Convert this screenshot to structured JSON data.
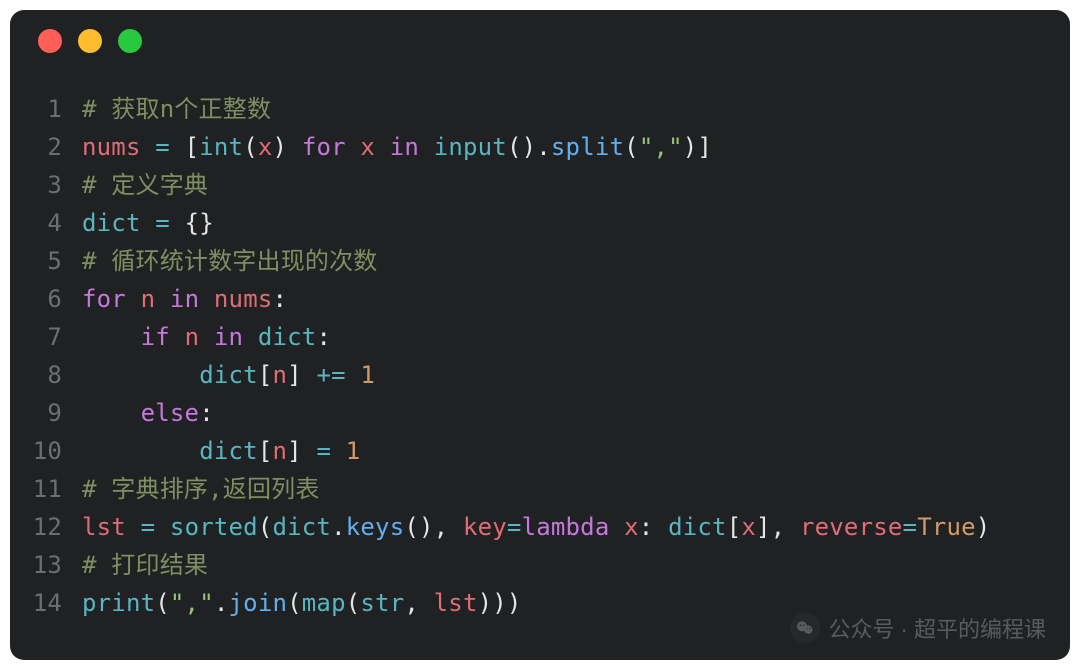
{
  "window": {
    "traffic_lights": [
      "close",
      "minimize",
      "zoom"
    ]
  },
  "colors": {
    "bg": "#1f2122",
    "gutter": "#6a6f73",
    "comment": "#7f8f61",
    "keyword": "#c678dd",
    "ident": "#e06c75",
    "string": "#98c379",
    "func": "#61afef",
    "operator": "#56b6c2",
    "builtin": "#56b6c2",
    "number": "#d19a66",
    "literal": "#d19a66",
    "plain": "#e5e5e5"
  },
  "code": {
    "language": "python",
    "lines": [
      {
        "n": "1",
        "tokens": [
          {
            "c": "cmt",
            "t": "# 获取n个正整数"
          }
        ]
      },
      {
        "n": "2",
        "tokens": [
          {
            "c": "id",
            "t": "nums"
          },
          {
            "c": "pl",
            "t": " "
          },
          {
            "c": "op",
            "t": "="
          },
          {
            "c": "pl",
            "t": " ["
          },
          {
            "c": "bi",
            "t": "int"
          },
          {
            "c": "pl",
            "t": "("
          },
          {
            "c": "id",
            "t": "x"
          },
          {
            "c": "pl",
            "t": ") "
          },
          {
            "c": "kw",
            "t": "for"
          },
          {
            "c": "pl",
            "t": " "
          },
          {
            "c": "id",
            "t": "x"
          },
          {
            "c": "pl",
            "t": " "
          },
          {
            "c": "kw",
            "t": "in"
          },
          {
            "c": "pl",
            "t": " "
          },
          {
            "c": "bi",
            "t": "input"
          },
          {
            "c": "pl",
            "t": "()."
          },
          {
            "c": "fn",
            "t": "split"
          },
          {
            "c": "pl",
            "t": "("
          },
          {
            "c": "str",
            "t": "\",\""
          },
          {
            "c": "pl",
            "t": ")]"
          }
        ]
      },
      {
        "n": "3",
        "tokens": [
          {
            "c": "cmt",
            "t": "# 定义字典"
          }
        ]
      },
      {
        "n": "4",
        "tokens": [
          {
            "c": "bi",
            "t": "dict"
          },
          {
            "c": "pl",
            "t": " "
          },
          {
            "c": "op",
            "t": "="
          },
          {
            "c": "pl",
            "t": " {}"
          }
        ]
      },
      {
        "n": "5",
        "tokens": [
          {
            "c": "cmt",
            "t": "# 循环统计数字出现的次数"
          }
        ]
      },
      {
        "n": "6",
        "tokens": [
          {
            "c": "kw",
            "t": "for"
          },
          {
            "c": "pl",
            "t": " "
          },
          {
            "c": "id",
            "t": "n"
          },
          {
            "c": "pl",
            "t": " "
          },
          {
            "c": "kw",
            "t": "in"
          },
          {
            "c": "pl",
            "t": " "
          },
          {
            "c": "id",
            "t": "nums"
          },
          {
            "c": "pl",
            "t": ":"
          }
        ]
      },
      {
        "n": "7",
        "tokens": [
          {
            "c": "pl",
            "t": "    "
          },
          {
            "c": "kw",
            "t": "if"
          },
          {
            "c": "pl",
            "t": " "
          },
          {
            "c": "id",
            "t": "n"
          },
          {
            "c": "pl",
            "t": " "
          },
          {
            "c": "kw",
            "t": "in"
          },
          {
            "c": "pl",
            "t": " "
          },
          {
            "c": "bi",
            "t": "dict"
          },
          {
            "c": "pl",
            "t": ":"
          }
        ]
      },
      {
        "n": "8",
        "tokens": [
          {
            "c": "pl",
            "t": "        "
          },
          {
            "c": "bi",
            "t": "dict"
          },
          {
            "c": "pl",
            "t": "["
          },
          {
            "c": "id",
            "t": "n"
          },
          {
            "c": "pl",
            "t": "] "
          },
          {
            "c": "op",
            "t": "+="
          },
          {
            "c": "pl",
            "t": " "
          },
          {
            "c": "num",
            "t": "1"
          }
        ]
      },
      {
        "n": "9",
        "tokens": [
          {
            "c": "pl",
            "t": "    "
          },
          {
            "c": "kw",
            "t": "else"
          },
          {
            "c": "pl",
            "t": ":"
          }
        ]
      },
      {
        "n": "10",
        "tokens": [
          {
            "c": "pl",
            "t": "        "
          },
          {
            "c": "bi",
            "t": "dict"
          },
          {
            "c": "pl",
            "t": "["
          },
          {
            "c": "id",
            "t": "n"
          },
          {
            "c": "pl",
            "t": "] "
          },
          {
            "c": "op",
            "t": "="
          },
          {
            "c": "pl",
            "t": " "
          },
          {
            "c": "num",
            "t": "1"
          }
        ]
      },
      {
        "n": "11",
        "tokens": [
          {
            "c": "cmt",
            "t": "# 字典排序,返回列表"
          }
        ]
      },
      {
        "n": "12",
        "tokens": [
          {
            "c": "id",
            "t": "lst"
          },
          {
            "c": "pl",
            "t": " "
          },
          {
            "c": "op",
            "t": "="
          },
          {
            "c": "pl",
            "t": " "
          },
          {
            "c": "bi",
            "t": "sorted"
          },
          {
            "c": "pl",
            "t": "("
          },
          {
            "c": "bi",
            "t": "dict"
          },
          {
            "c": "pl",
            "t": "."
          },
          {
            "c": "fn",
            "t": "keys"
          },
          {
            "c": "pl",
            "t": "(), "
          },
          {
            "c": "id",
            "t": "key"
          },
          {
            "c": "op",
            "t": "="
          },
          {
            "c": "kw",
            "t": "lambda"
          },
          {
            "c": "pl",
            "t": " "
          },
          {
            "c": "id",
            "t": "x"
          },
          {
            "c": "pl",
            "t": ": "
          },
          {
            "c": "bi",
            "t": "dict"
          },
          {
            "c": "pl",
            "t": "["
          },
          {
            "c": "id",
            "t": "x"
          },
          {
            "c": "pl",
            "t": "], "
          },
          {
            "c": "id",
            "t": "reverse"
          },
          {
            "c": "op",
            "t": "="
          },
          {
            "c": "lit",
            "t": "True"
          },
          {
            "c": "pl",
            "t": ")"
          }
        ]
      },
      {
        "n": "13",
        "tokens": [
          {
            "c": "cmt",
            "t": "# 打印结果"
          }
        ]
      },
      {
        "n": "14",
        "tokens": [
          {
            "c": "bi",
            "t": "print"
          },
          {
            "c": "pl",
            "t": "("
          },
          {
            "c": "str",
            "t": "\",\""
          },
          {
            "c": "pl",
            "t": "."
          },
          {
            "c": "fn",
            "t": "join"
          },
          {
            "c": "pl",
            "t": "("
          },
          {
            "c": "bi",
            "t": "map"
          },
          {
            "c": "pl",
            "t": "("
          },
          {
            "c": "bi",
            "t": "str"
          },
          {
            "c": "pl",
            "t": ", "
          },
          {
            "c": "id",
            "t": "lst"
          },
          {
            "c": "pl",
            "t": ")))"
          }
        ]
      }
    ]
  },
  "watermark": {
    "icon": "wechat-icon",
    "text": "公众号 · 超平的编程课"
  }
}
